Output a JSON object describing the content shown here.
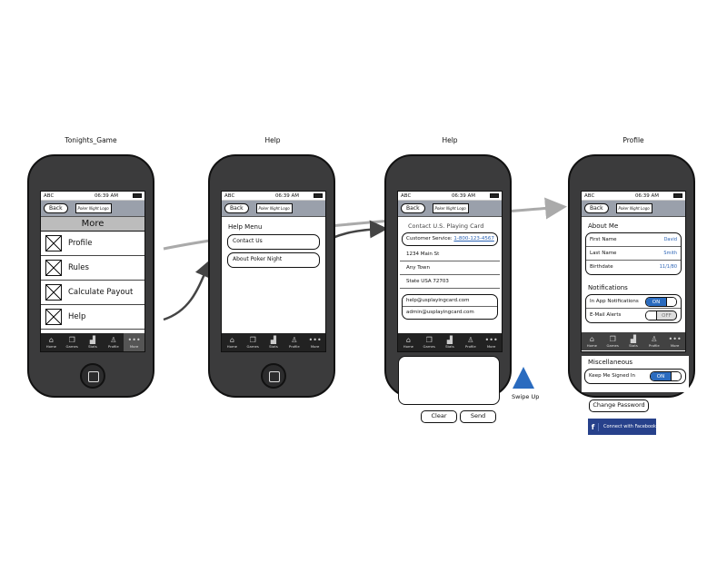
{
  "screens": [
    {
      "title": "Tonights_Game"
    },
    {
      "title": "Help"
    },
    {
      "title": "Help"
    },
    {
      "title": "Profile"
    }
  ],
  "status_bar": {
    "carrier": "ABC",
    "time": "06:39 AM"
  },
  "nav": {
    "back_label": "Back",
    "logo_text": "Poker Night Logo"
  },
  "tabs": [
    {
      "label": "Home",
      "icon": "home-icon"
    },
    {
      "label": "Games",
      "icon": "games-icon"
    },
    {
      "label": "Stats",
      "icon": "stats-icon"
    },
    {
      "label": "Profile",
      "icon": "profile-icon"
    },
    {
      "label": "More",
      "icon": "more-icon"
    }
  ],
  "more_screen": {
    "header": "More",
    "items": [
      "Profile",
      "Rules",
      "Calculate Payout",
      "Help"
    ]
  },
  "help_menu": {
    "title": "Help Menu",
    "items": [
      "Contact Us",
      "About Poker Night"
    ]
  },
  "contact": {
    "title": "Contact U.S. Playing Card",
    "service_label": "Customer Service:",
    "service_phone": "1-800-123-4567",
    "address": [
      "1234 Main St",
      "Any Town",
      "State USA 72703"
    ],
    "emails": [
      "help@usplayingcard.com",
      "admin@usplayingcard.com"
    ],
    "clear_label": "Clear",
    "send_label": "Send",
    "swipe_label": "Swipe Up"
  },
  "profile": {
    "about_title": "About Me",
    "fields": [
      {
        "label": "First Name",
        "value": "David"
      },
      {
        "label": "Last Name",
        "value": "Smith"
      },
      {
        "label": "Birthdate",
        "value": "11/1/80"
      }
    ],
    "notifications_title": "Notifications",
    "notifications": [
      {
        "label": "In App Notifications",
        "state": "ON"
      },
      {
        "label": "E-Mail Alerts",
        "state": "OFF"
      }
    ],
    "misc_title": "Miscellaneous",
    "misc": [
      {
        "label": "Keep Me Signed In",
        "state": "ON"
      }
    ],
    "change_password_label": "Change Password",
    "facebook_label": "Connect with Facebook",
    "facebook_icon": "f"
  },
  "colors": {
    "accent": "#2a6bbf",
    "facebook": "#27418b",
    "phone_body": "#3b3b3c",
    "nav_bar": "#9aa0ab"
  }
}
